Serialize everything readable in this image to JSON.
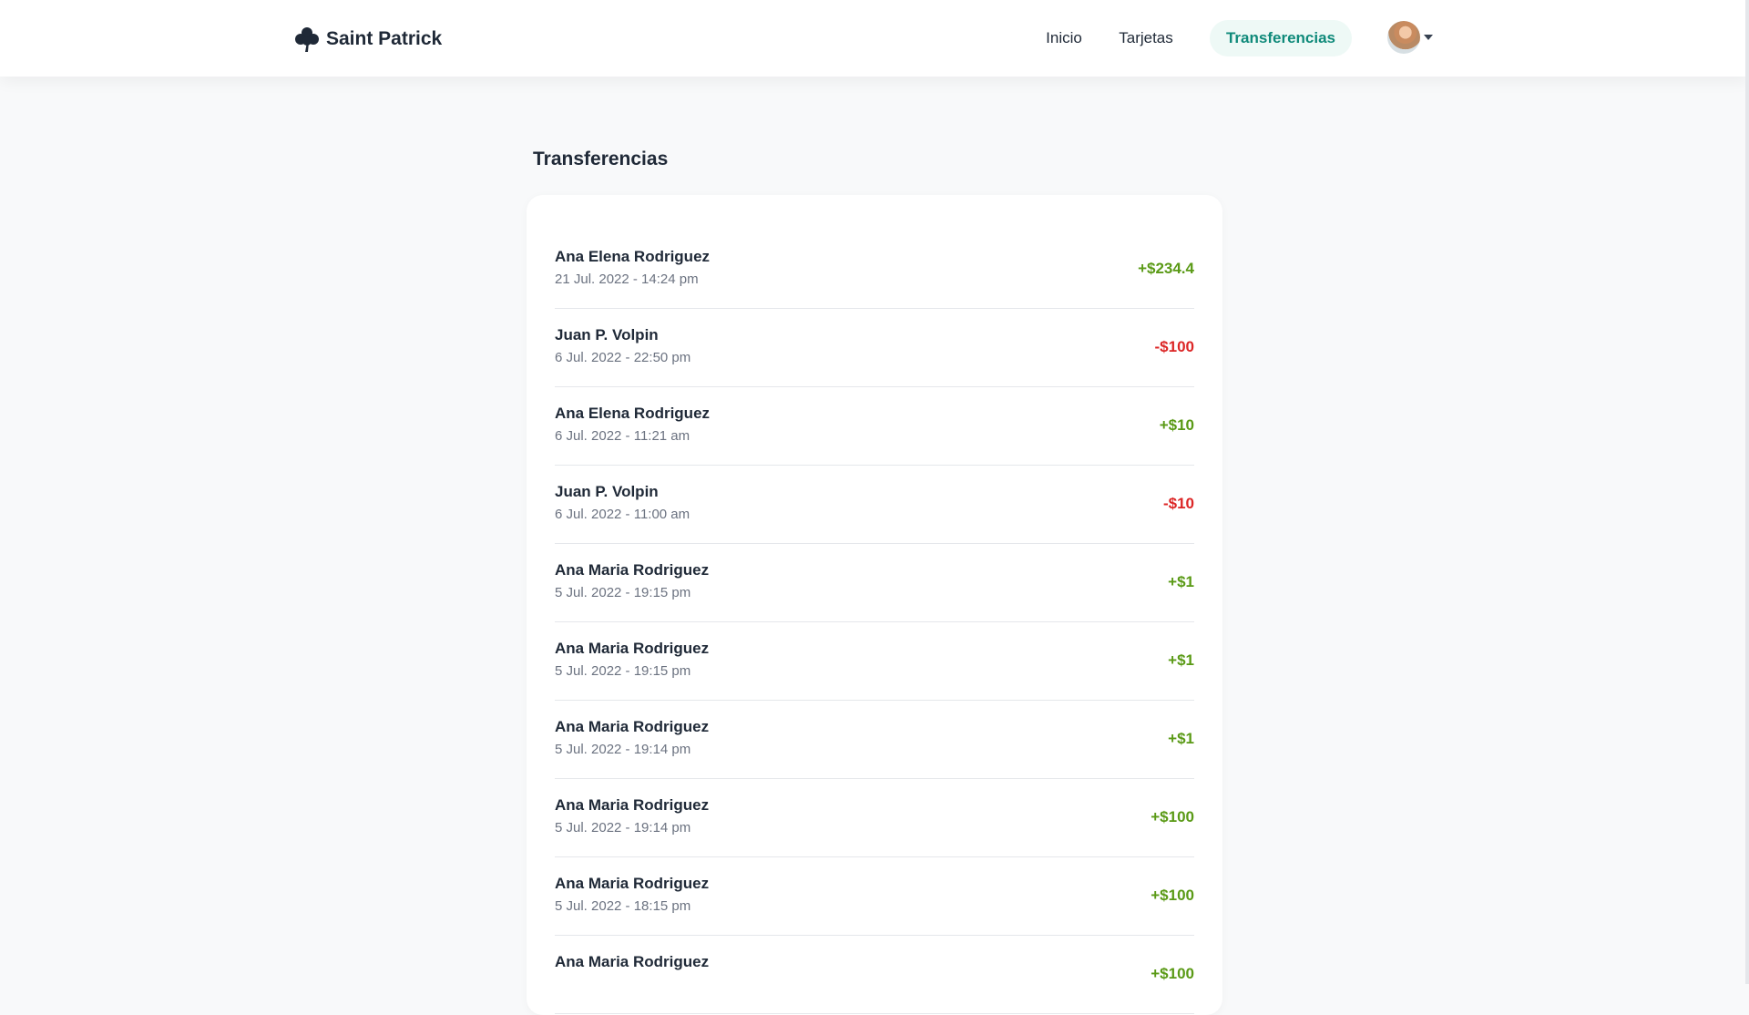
{
  "brand": {
    "name": "Saint Patrick",
    "icon": "clover-icon"
  },
  "nav": {
    "inicio": "Inicio",
    "tarjetas": "Tarjetas",
    "transferencias": "Transferencias",
    "active": "Transferencias"
  },
  "profile": {
    "avatar": "user-avatar",
    "menu_icon": "caret-down-icon"
  },
  "page": {
    "title": "Transferencias"
  },
  "colors": {
    "positive": "#5a9a16",
    "negative": "#dc2626",
    "accent": "#0f8a7a"
  },
  "transfers": [
    {
      "name": "Ana Elena Rodriguez",
      "date": "21 Jul. 2022 - 14:24 pm",
      "amount": "+$234.4"
    },
    {
      "name": "Juan P. Volpin",
      "date": "6 Jul. 2022 - 22:50 pm",
      "amount": "-$100"
    },
    {
      "name": "Ana Elena Rodriguez",
      "date": "6 Jul. 2022 - 11:21 am",
      "amount": "+$10"
    },
    {
      "name": "Juan P. Volpin",
      "date": "6 Jul. 2022 - 11:00 am",
      "amount": "-$10"
    },
    {
      "name": "Ana Maria Rodriguez",
      "date": "5 Jul. 2022 - 19:15 pm",
      "amount": "+$1"
    },
    {
      "name": "Ana Maria Rodriguez",
      "date": "5 Jul. 2022 - 19:15 pm",
      "amount": "+$1"
    },
    {
      "name": "Ana Maria Rodriguez",
      "date": "5 Jul. 2022 - 19:14 pm",
      "amount": "+$1"
    },
    {
      "name": "Ana Maria Rodriguez",
      "date": "5 Jul. 2022 - 19:14 pm",
      "amount": "+$100"
    },
    {
      "name": "Ana Maria Rodriguez",
      "date": "5 Jul. 2022 - 18:15 pm",
      "amount": "+$100"
    },
    {
      "name": "Ana Maria Rodriguez",
      "date": "",
      "amount": "+$100"
    }
  ]
}
